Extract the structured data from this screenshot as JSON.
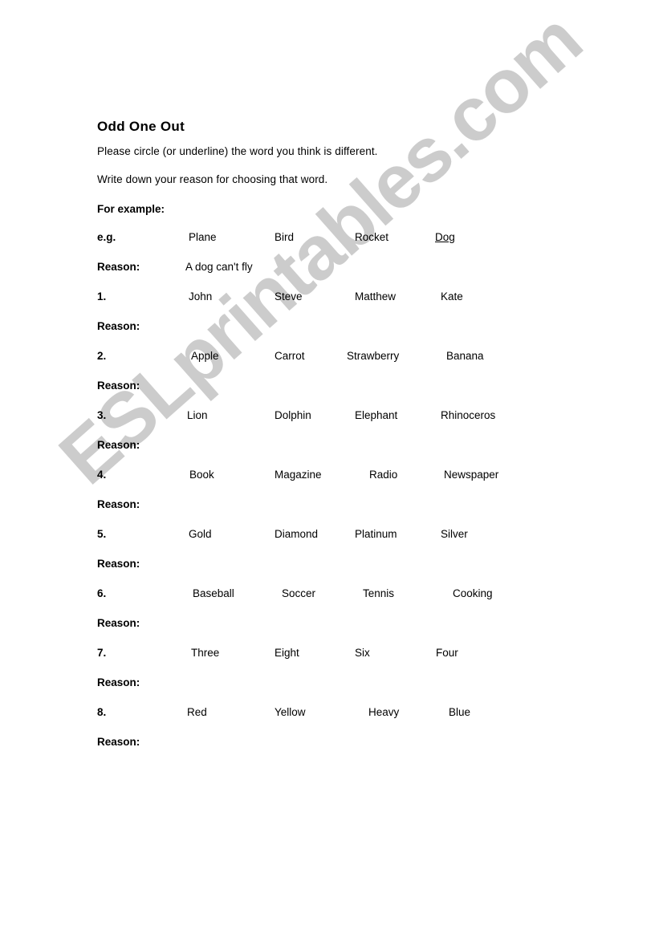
{
  "document": {
    "title": "Odd One Out",
    "instructions": [
      "Please circle (or underline) the word you think is different.",
      "Write down your reason for choosing that word."
    ],
    "section_label": "For example:",
    "reason_label": "Reason:",
    "example": {
      "label": "e.g.",
      "words": [
        "Plane",
        "Bird",
        "Rocket",
        "Dog"
      ],
      "answer_index": 3,
      "reason": "A dog can't fly"
    },
    "items": [
      {
        "label": "1.",
        "words": [
          "John",
          "Steve",
          "Matthew",
          "Kate"
        ],
        "reason": ""
      },
      {
        "label": "2.",
        "words": [
          "Apple",
          "Carrot",
          "Strawberry",
          "Banana"
        ],
        "reason": ""
      },
      {
        "label": "3.",
        "words": [
          "Lion",
          "Dolphin",
          "Elephant",
          "Rhinoceros"
        ],
        "reason": ""
      },
      {
        "label": "4.",
        "words": [
          "Book",
          "Magazine",
          "Radio",
          "Newspaper"
        ],
        "reason": ""
      },
      {
        "label": "5.",
        "words": [
          "Gold",
          "Diamond",
          "Platinum",
          "Silver"
        ],
        "reason": ""
      },
      {
        "label": "6.",
        "words": [
          "Baseball",
          "Soccer",
          "Tennis",
          "Cooking"
        ],
        "reason": ""
      },
      {
        "label": "7.",
        "words": [
          "Three",
          "Eight",
          "Six",
          "Four"
        ],
        "reason": ""
      },
      {
        "label": "8.",
        "words": [
          "Red",
          "Yellow",
          "Heavy",
          "Blue"
        ],
        "reason": ""
      }
    ]
  },
  "watermark": {
    "text": "ESLprintables.com",
    "color": "#cccccc"
  }
}
